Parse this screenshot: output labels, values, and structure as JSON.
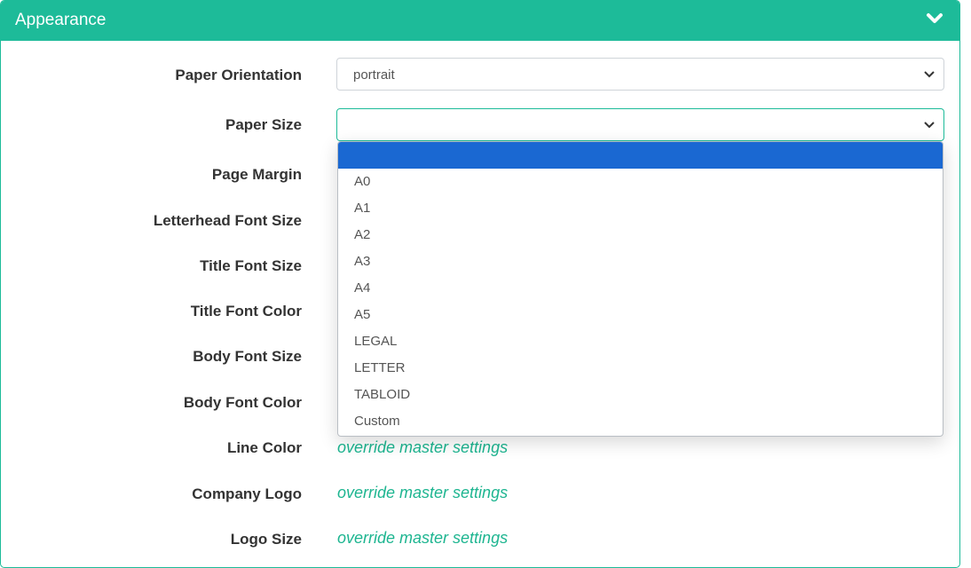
{
  "panel": {
    "title": "Appearance",
    "header_color": "#1dbb99",
    "collapse_icon": "chevron-down-icon"
  },
  "fields": {
    "paper_orientation": {
      "label": "Paper Orientation",
      "value": "portrait"
    },
    "paper_size": {
      "label": "Paper Size",
      "value": ""
    },
    "page_margin": {
      "label": "Page Margin"
    },
    "letterhead_font_size": {
      "label": "Letterhead Font Size"
    },
    "title_font_size": {
      "label": "Title Font Size"
    },
    "title_font_color": {
      "label": "Title Font Color"
    },
    "body_font_size": {
      "label": "Body Font Size"
    },
    "body_font_color": {
      "label": "Body Font Color"
    },
    "line_color": {
      "label": "Line Color",
      "override": "override master settings"
    },
    "company_logo": {
      "label": "Company Logo",
      "override": "override master settings"
    },
    "logo_size": {
      "label": "Logo Size",
      "override": "override master settings"
    }
  },
  "dropdown": {
    "highlight_color": "#1a68d2",
    "options": [
      "",
      "A0",
      "A1",
      "A2",
      "A3",
      "A4",
      "A5",
      "LEGAL",
      "LETTER",
      "TABLOID",
      "Custom"
    ]
  }
}
